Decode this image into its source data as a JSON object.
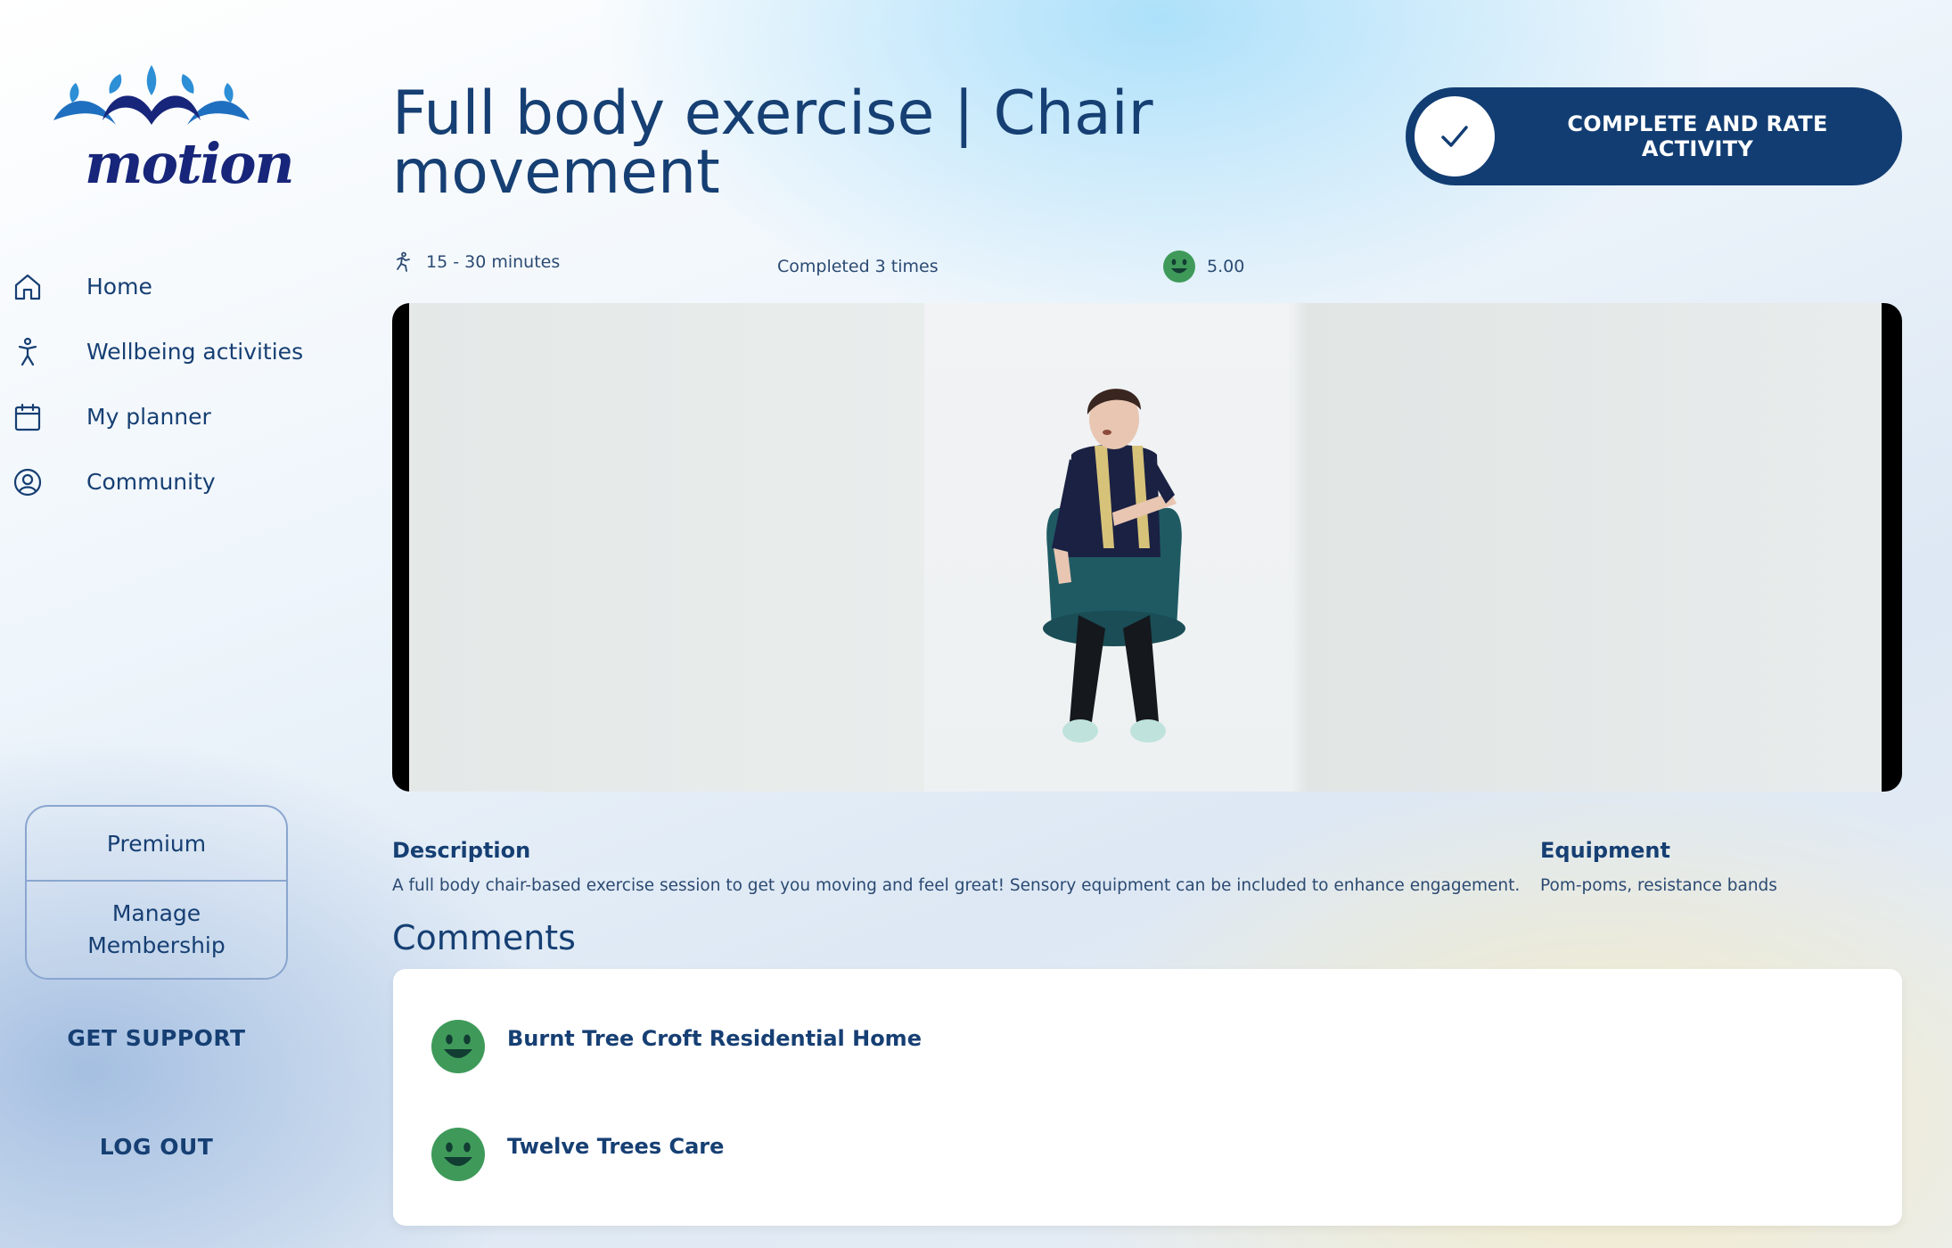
{
  "brand": {
    "name": "motion"
  },
  "sidebar": {
    "nav": [
      {
        "label": "Home",
        "icon": "home-icon"
      },
      {
        "label": "Wellbeing activities",
        "icon": "person-activity-icon"
      },
      {
        "label": "My planner",
        "icon": "calendar-icon"
      },
      {
        "label": "Community",
        "icon": "user-circle-icon"
      }
    ],
    "premium_label": "Premium",
    "manage_label": "Manage Membership",
    "support_label": "GET SUPPORT",
    "logout_label": "LOG OUT"
  },
  "activity": {
    "title": "Full body exercise | Chair movement",
    "complete_label": "COMPLETE AND RATE ACTIVITY",
    "duration": "15 - 30 minutes",
    "completed": "Completed 3 times",
    "rating": "5.00"
  },
  "details": {
    "description_heading": "Description",
    "description_text": "A full body chair-based exercise session to get you moving and feel great! Sensory equipment can be included to enhance engagement.",
    "equipment_heading": "Equipment",
    "equipment_text": "Pom-poms, resistance bands"
  },
  "comments": {
    "heading": "Comments",
    "items": [
      {
        "name": "Burnt Tree Croft Residential Home",
        "icon": "happy-face-icon"
      },
      {
        "name": "Twelve Trees Care",
        "icon": "happy-face-icon"
      }
    ]
  },
  "colors": {
    "primary": "#123d73",
    "text": "#163f73",
    "smiley_green": "#3f9a5a",
    "logo_blue": "#1f7fcf"
  }
}
